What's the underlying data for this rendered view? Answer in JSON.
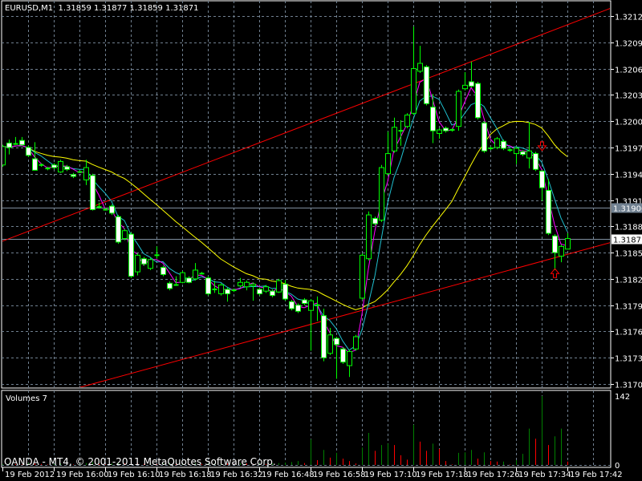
{
  "header": {
    "symbol_timeframe": "EURUSD,M1",
    "ohlc": "1.31859 1.31877 1.31859 1.31871"
  },
  "volume_panel": {
    "label": "Volumes 7",
    "max_label": "142",
    "min_label": "0"
  },
  "copyright": "OANDA - MT4, © 2001-2011 MetaQuotes Software Corp.",
  "colors": {
    "background": "#000000",
    "grid": "#708090",
    "axis": "#ffffff",
    "candle_outline": "#00ff00",
    "bear_body": "#ffffff",
    "bull_body": "#000000",
    "trendline": "#ff0000",
    "ma_fast": "#ff00ff",
    "ma_mid": "#20c0d0",
    "ma_slow": "#ffff00",
    "hline": "#8090a0",
    "volume_up": "#008000",
    "volume_down": "#ff0000",
    "arrow": "#ff0000",
    "bid_label_bg": "#ffffff",
    "line_label_bg": "#708090"
  },
  "chart_data": {
    "type": "candlestick",
    "title": "EURUSD,M1",
    "ylim": [
      1.31705,
      1.32125
    ],
    "yticks": [
      "1.32125",
      "1.32095",
      "1.32065",
      "1.32035",
      "1.32005",
      "1.31975",
      "1.31945",
      "1.31915",
      "1.31885",
      "1.31855",
      "1.31825",
      "1.31795",
      "1.31765",
      "1.31735",
      "1.31705"
    ],
    "xticks": [
      {
        "bar": 0,
        "label": "19 Feb 2012"
      },
      {
        "bar": 8,
        "label": "19 Feb 16:00"
      },
      {
        "bar": 16,
        "label": "19 Feb 16:10"
      },
      {
        "bar": 24,
        "label": "19 Feb 16:18"
      },
      {
        "bar": 32,
        "label": "19 Feb 16:32"
      },
      {
        "bar": 40,
        "label": "19 Feb 16:48"
      },
      {
        "bar": 48,
        "label": "19 Feb 16:58"
      },
      {
        "bar": 56,
        "label": "19 Feb 17:10"
      },
      {
        "bar": 64,
        "label": "19 Feb 17:18"
      },
      {
        "bar": 72,
        "label": "19 Feb 17:26"
      },
      {
        "bar": 80,
        "label": "19 Feb 17:34"
      },
      {
        "bar": 88,
        "label": "19 Feb 17:42"
      }
    ],
    "grid": true,
    "candles_ohlc": [
      [
        1.31955,
        1.31978,
        1.31953,
        1.31976
      ],
      [
        1.3198,
        1.31984,
        1.31967,
        1.31975
      ],
      [
        1.31979,
        1.31987,
        1.31978,
        1.31979
      ],
      [
        1.31983,
        1.31987,
        1.31977,
        1.31978
      ],
      [
        1.31975,
        1.31977,
        1.31964,
        1.31966
      ],
      [
        1.31962,
        1.31981,
        1.31949,
        1.31949
      ],
      [
        1.31955,
        1.31957,
        1.31953,
        1.31955
      ],
      [
        1.31951,
        1.31953,
        1.31949,
        1.31951
      ],
      [
        1.31955,
        1.31957,
        1.3195,
        1.31952
      ],
      [
        1.31947,
        1.31961,
        1.31946,
        1.31959
      ],
      [
        1.31953,
        1.31955,
        1.31948,
        1.3195
      ],
      [
        1.31944,
        1.31946,
        1.3194,
        1.31942
      ],
      [
        1.31947,
        1.31949,
        1.31946,
        1.31947
      ],
      [
        1.31938,
        1.31961,
        1.31932,
        1.31952
      ],
      [
        1.31943,
        1.31945,
        1.31903,
        1.31904
      ],
      [
        1.31907,
        1.31912,
        1.31905,
        1.31907
      ],
      [
        1.31904,
        1.31906,
        1.31903,
        1.31904
      ],
      [
        1.31908,
        1.3191,
        1.31898,
        1.319
      ],
      [
        1.31896,
        1.31898,
        1.31865,
        1.31867
      ],
      [
        1.31871,
        1.31882,
        1.31869,
        1.3188
      ],
      [
        1.31876,
        1.31878,
        1.31826,
        1.31828
      ],
      [
        1.31833,
        1.31854,
        1.31829,
        1.31852
      ],
      [
        1.31848,
        1.3185,
        1.3184,
        1.31842
      ],
      [
        1.31837,
        1.31849,
        1.31835,
        1.31847
      ],
      [
        1.31852,
        1.31862,
        1.31848,
        1.31852
      ],
      [
        1.31838,
        1.3184,
        1.31828,
        1.3183
      ],
      [
        1.3182,
        1.31822,
        1.31812,
        1.31814
      ],
      [
        1.31818,
        1.31828,
        1.31817,
        1.31818
      ],
      [
        1.31821,
        1.31834,
        1.3182,
        1.31832
      ],
      [
        1.31826,
        1.31828,
        1.3182,
        1.31821
      ],
      [
        1.31825,
        1.31843,
        1.31823,
        1.31835
      ],
      [
        1.31831,
        1.31833,
        1.3183,
        1.31831
      ],
      [
        1.31826,
        1.31828,
        1.31806,
        1.31808
      ],
      [
        1.31813,
        1.31823,
        1.31809,
        1.31813
      ],
      [
        1.31808,
        1.3182,
        1.31806,
        1.31818
      ],
      [
        1.31813,
        1.31815,
        1.31799,
        1.31808
      ],
      [
        1.31812,
        1.31814,
        1.3181,
        1.31812
      ],
      [
        1.31817,
        1.31826,
        1.31815,
        1.31821
      ],
      [
        1.31816,
        1.31823,
        1.31812,
        1.31821
      ],
      [
        1.31817,
        1.31821,
        1.318,
        1.31819
      ],
      [
        1.31813,
        1.31815,
        1.31806,
        1.31808
      ],
      [
        1.31811,
        1.31818,
        1.31809,
        1.31816
      ],
      [
        1.31811,
        1.31813,
        1.31804,
        1.31806
      ],
      [
        1.3181,
        1.31825,
        1.31809,
        1.31823
      ],
      [
        1.31819,
        1.31824,
        1.318,
        1.31802
      ],
      [
        1.31799,
        1.31801,
        1.31789,
        1.31791
      ],
      [
        1.31795,
        1.31797,
        1.31786,
        1.31788
      ],
      [
        1.31801,
        1.31803,
        1.31795,
        1.31797
      ],
      [
        1.31789,
        1.31802,
        1.31743,
        1.318
      ],
      [
        1.31795,
        1.31805,
        1.31777,
        1.31795
      ],
      [
        1.31783,
        1.31791,
        1.31731,
        1.31735
      ],
      [
        1.3174,
        1.31769,
        1.31738,
        1.31761
      ],
      [
        1.31757,
        1.31759,
        1.31711,
        1.3175
      ],
      [
        1.31745,
        1.31747,
        1.31728,
        1.3173
      ],
      [
        1.31726,
        1.31744,
        1.31713,
        1.31742
      ],
      [
        1.31745,
        1.31761,
        1.31743,
        1.31759
      ],
      [
        1.31803,
        1.31854,
        1.31801,
        1.31852
      ],
      [
        1.31848,
        1.31902,
        1.31846,
        1.31898
      ],
      [
        1.31894,
        1.31896,
        1.31886,
        1.31888
      ],
      [
        1.31892,
        1.31955,
        1.3189,
        1.31952
      ],
      [
        1.31945,
        1.31993,
        1.31943,
        1.31968
      ],
      [
        1.31971,
        1.32009,
        1.31969,
        1.31998
      ],
      [
        1.31994,
        1.32006,
        1.31977,
        1.31994
      ],
      [
        1.31999,
        1.32014,
        1.31997,
        1.32012
      ],
      [
        1.32014,
        1.32113,
        1.32012,
        1.32065
      ],
      [
        1.32062,
        1.32091,
        1.3206,
        1.32071
      ],
      [
        1.32067,
        1.32069,
        1.32023,
        1.32025
      ],
      [
        1.32021,
        1.32036,
        1.3198,
        1.31994
      ],
      [
        1.31991,
        1.31997,
        1.31985,
        1.31995
      ],
      [
        1.31997,
        1.31999,
        1.31992,
        1.31994
      ],
      [
        1.31995,
        1.31997,
        1.31993,
        1.31995
      ],
      [
        1.31999,
        1.32041,
        1.31994,
        1.32039
      ],
      [
        1.32042,
        1.32061,
        1.3204,
        1.32046
      ],
      [
        1.3205,
        1.32073,
        1.32043,
        1.32045
      ],
      [
        1.32048,
        1.3205,
        1.32007,
        1.32009
      ],
      [
        1.32003,
        1.32005,
        1.31969,
        1.31971
      ],
      [
        1.31974,
        1.31976,
        1.31972,
        1.31974
      ],
      [
        1.31975,
        1.31987,
        1.31973,
        1.31985
      ],
      [
        1.31982,
        1.31984,
        1.31972,
        1.31974
      ],
      [
        1.31972,
        1.31974,
        1.3197,
        1.31972
      ],
      [
        1.31968,
        1.31976,
        1.31956,
        1.31974
      ],
      [
        1.3197,
        1.31972,
        1.31965,
        1.31967
      ],
      [
        1.31963,
        1.32004,
        1.31951,
        1.31971
      ],
      [
        1.31968,
        1.3197,
        1.31948,
        1.3195
      ],
      [
        1.31948,
        1.31949,
        1.31914,
        1.31929
      ],
      [
        1.31926,
        1.31939,
        1.31875,
        1.31877
      ],
      [
        1.31874,
        1.31876,
        1.31835,
        1.31855
      ],
      [
        1.31851,
        1.31864,
        1.31844,
        1.31862
      ],
      [
        1.31859,
        1.31877,
        1.31859,
        1.31871
      ]
    ],
    "volumes": [
      2,
      3,
      2,
      1,
      4,
      3,
      2,
      1,
      2,
      3,
      2,
      1,
      2,
      4,
      6,
      2,
      1,
      3,
      5,
      3,
      6,
      4,
      2,
      3,
      2,
      3,
      4,
      2,
      3,
      2,
      4,
      2,
      3,
      3,
      5,
      3,
      2,
      4,
      3,
      2,
      3,
      2,
      3,
      4,
      5,
      6,
      8,
      4,
      53,
      10,
      31,
      15,
      25,
      13,
      8,
      3,
      36,
      66,
      29,
      41,
      44,
      41,
      20,
      11,
      83,
      48,
      29,
      44,
      33,
      8,
      1,
      25,
      26,
      31,
      13,
      26,
      8,
      7,
      7,
      1,
      10,
      23,
      75,
      54,
      142,
      41,
      59,
      75,
      7
    ],
    "volume_ylim": [
      0,
      142
    ],
    "hlines": [
      {
        "price": 1.31906,
        "label": "1.31906",
        "style": "line"
      },
      {
        "price": 1.31871,
        "label": "1.31871",
        "style": "bid"
      }
    ],
    "trendlines": [
      {
        "from_bar": 0,
        "from_price": 1.31868,
        "to_bar": 88,
        "to_price": 1.32115
      },
      {
        "from_bar": 12,
        "from_price": 1.31701,
        "to_bar": 88,
        "to_price": 1.31853
      }
    ],
    "arrows": [
      {
        "direction": "down",
        "bar": 84,
        "price": 1.31976
      },
      {
        "direction": "up",
        "bar": 86,
        "price": 1.31832
      }
    ]
  }
}
